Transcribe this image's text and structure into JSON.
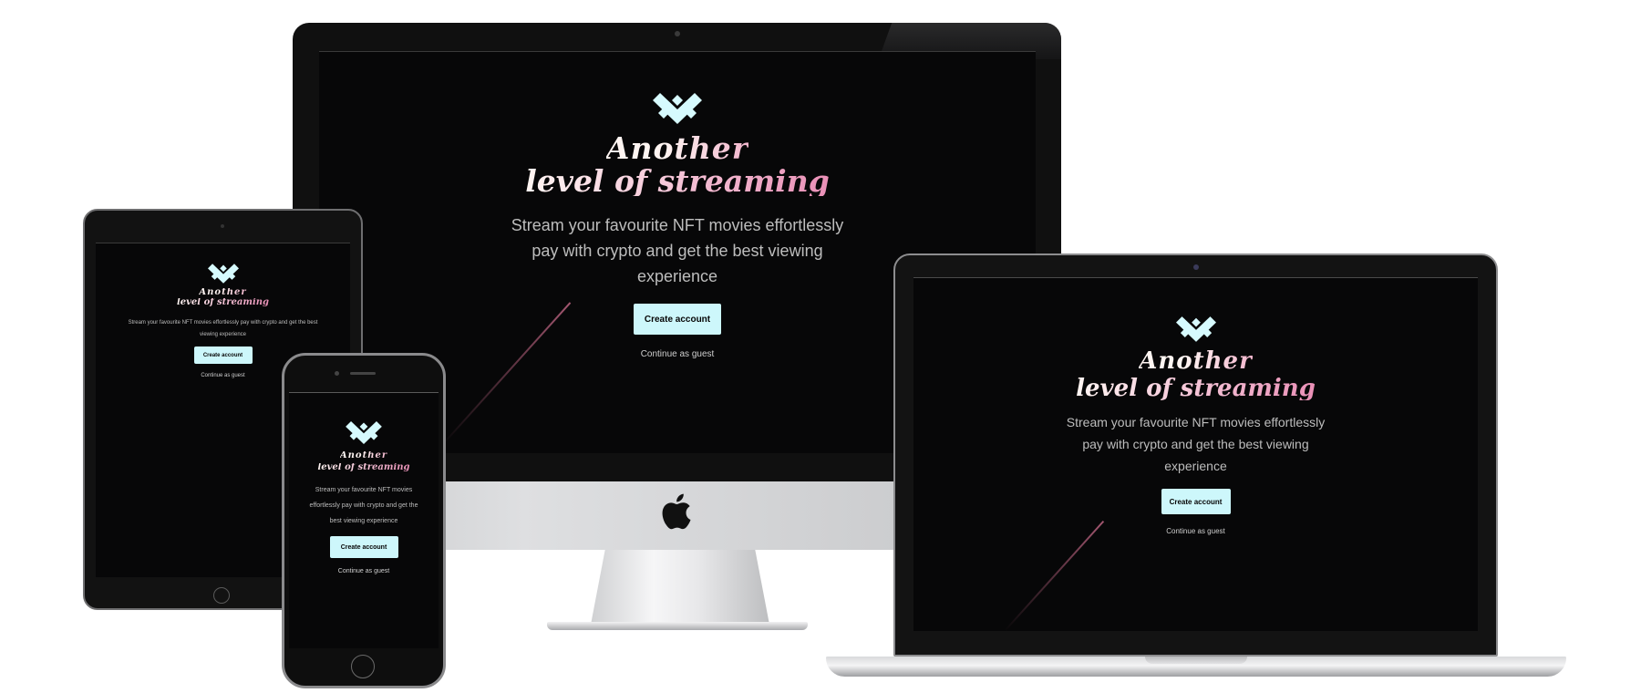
{
  "brand": {
    "logo_icon": "m-monogram-icon",
    "title_line1": "Another",
    "title_line2": "level of streaming",
    "tagline_line1": "Stream your favourite NFT movies effortlessly",
    "tagline_line2": "pay with crypto and get the best viewing",
    "tagline_line3": "experience",
    "accent_color": "#cdf7fb",
    "title_gradient": [
      "#fff5f2",
      "#e98fb6"
    ]
  },
  "tablet": {
    "tagline_line1": "Stream your favourite NFT movies effortlessly pay with crypto and get the best",
    "tagline_line2": "viewing experience"
  },
  "phone": {
    "tagline_line1": "Stream your favourite NFT movies",
    "tagline_line2": "effortlessly pay with crypto and get the",
    "tagline_line3": "best viewing experience"
  },
  "actions": {
    "create_account": "Create account",
    "continue_guest": "Continue as guest"
  },
  "devices": {
    "desktop_icon": "apple-logo-icon"
  }
}
